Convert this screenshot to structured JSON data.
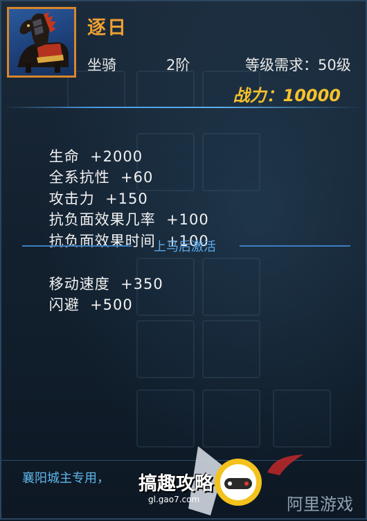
{
  "item": {
    "name": "逐日",
    "type": "坐骑",
    "tier": "2阶",
    "level_requirement": "等级需求：50级",
    "power": "战力：10000"
  },
  "stats": [
    {
      "label": "生命",
      "value": "+2000"
    },
    {
      "label": "全系抗性",
      "value": "+60"
    },
    {
      "label": "攻击力",
      "value": "+150"
    },
    {
      "label": "抗负面效果几率",
      "value": "+100"
    },
    {
      "label": "抗负面效果时间",
      "value": "+100"
    }
  ],
  "mounted_section": {
    "title": "上马后激活",
    "stats": [
      {
        "label": "移动速度",
        "value": "+350"
      },
      {
        "label": "闪避",
        "value": "+500"
      }
    ]
  },
  "footer": {
    "exclusive_text": "襄阳城主专用，"
  },
  "watermark": {
    "brand": "搞趣攻略",
    "url": "gl.gao7.com",
    "right_brand": "阿里游戏"
  },
  "colors": {
    "name": "#f0a032",
    "power": "#f7c12c",
    "section_title": "#5ea8ec",
    "portrait_border": "#d8862a"
  }
}
